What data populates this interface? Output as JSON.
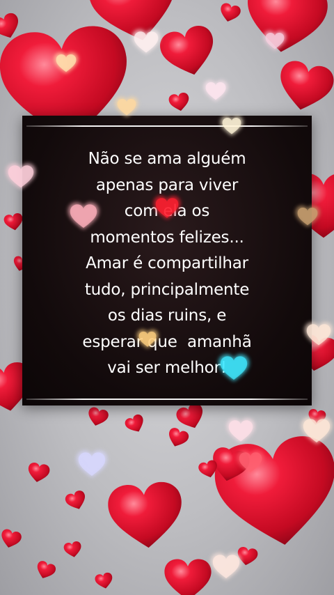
{
  "quote": {
    "lines": [
      "Não se ama alguém",
      "apenas para viver",
      "com ela os",
      "momentos felizes...",
      "Amar é compartilhar",
      "tudo, principalmente",
      "os dias ruins, e",
      "esperar que  amanhã",
      "vai ser melhor!"
    ]
  },
  "colors": {
    "heart_red": "#e0102a",
    "heart_highlight": "#ff6a80",
    "card_background": "#140b0c",
    "text": "#ffffff",
    "rule": "#f4f4f4"
  },
  "icons": {
    "background_hearts": "heart-icon",
    "sparkle_hearts": "heart-icon"
  }
}
